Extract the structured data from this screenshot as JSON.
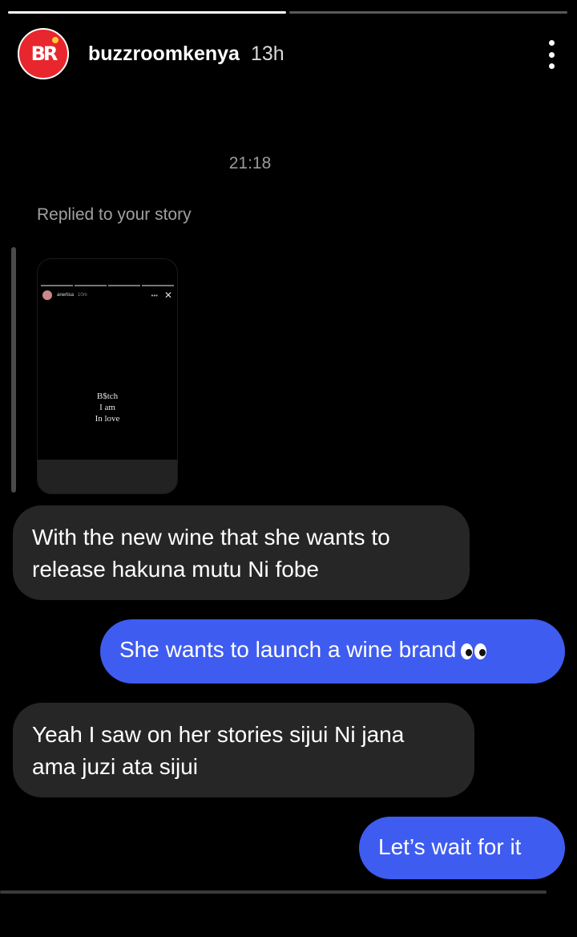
{
  "header": {
    "avatar_logo": "BR",
    "username": "buzzroomkenya",
    "time_ago": "13h"
  },
  "chat": {
    "timestamp": "21:18",
    "replied_label": "Replied to your story",
    "story_preview": {
      "user": "anerlisa",
      "time": "10m",
      "line1": "B$tch",
      "line2": "I am",
      "line3": "In love"
    },
    "messages": [
      {
        "side": "in",
        "text_line1": "With the new wine that she wants to",
        "text_line2": "release hakuna mutu Ni fobe"
      },
      {
        "side": "out",
        "text": "She wants to launch a wine brand"
      },
      {
        "side": "in",
        "text_line1": "Yeah I saw on her stories sijui Ni jana",
        "text_line2": "ama juzi ata sijui"
      },
      {
        "side": "out",
        "text": "Let’s wait for it"
      }
    ]
  },
  "colors": {
    "background": "#000000",
    "incoming_bubble": "#262626",
    "outgoing_bubble": "#3f5cf0",
    "avatar": "#e8262d"
  }
}
